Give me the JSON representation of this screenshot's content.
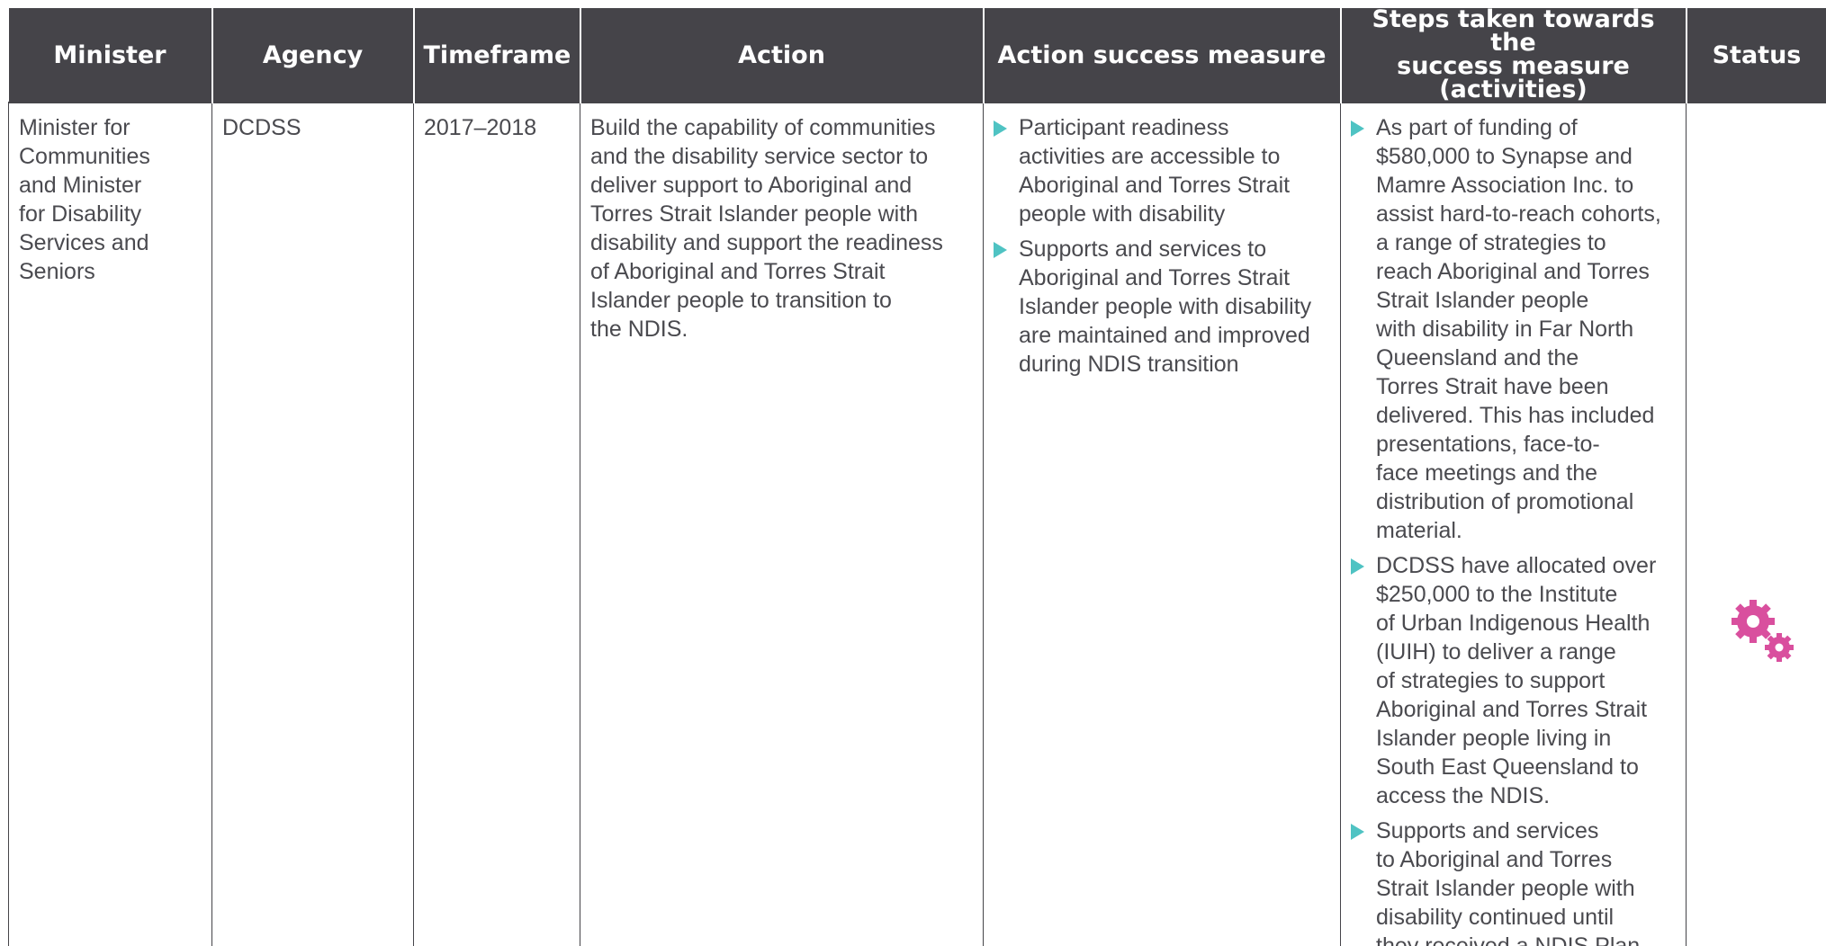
{
  "headers": {
    "minister": "Minister",
    "agency": "Agency",
    "timeframe": "Timeframe",
    "action": "Action",
    "success_measure": "Action success measure",
    "steps_line1": "Steps taken towards the",
    "steps_line2": "success measure (activities)",
    "status": "Status"
  },
  "row": {
    "minister_lines": [
      "Minister for",
      "Communities",
      "and Minister",
      "for Disability",
      "Services and",
      "Seniors"
    ],
    "agency": "DCDSS",
    "timeframe": "2017–2018",
    "action_lines": [
      "Build the capability of communities",
      "and the disability service sector to",
      "deliver support to Aboriginal and",
      "Torres Strait Islander people with",
      "disability and support the readiness",
      "of Aboriginal and Torres Strait",
      "Islander people to transition to",
      "the NDIS."
    ],
    "success_measures": [
      {
        "lines": [
          "Participant readiness",
          "activities are accessible to",
          "Aboriginal and Torres Strait",
          "people with disability"
        ]
      },
      {
        "lines": [
          "Supports and services to",
          "Aboriginal and Torres Strait",
          "Islander people with disability",
          "are maintained and improved",
          "during NDIS transition"
        ]
      }
    ],
    "activities": [
      {
        "lines": [
          "As part of funding of",
          "$580,000 to Synapse and",
          "Mamre Association Inc. to",
          "assist hard-to-reach cohorts,",
          "a range of strategies to",
          "reach Aboriginal and Torres",
          "Strait Islander people",
          "with disability in Far North",
          "Queensland and the",
          "Torres Strait  have been",
          "delivered. This has included",
          "presentations, face-to-",
          "face meetings and the",
          "distribution of promotional",
          "material."
        ]
      },
      {
        "lines": [
          "DCDSS have allocated over",
          "$250,000 to the Institute",
          "of Urban Indigenous Health",
          "(IUIH) to deliver a range",
          "of strategies to support",
          "Aboriginal and Torres Strait",
          "Islander people living in",
          "South East Queensland to",
          "access the NDIS."
        ]
      },
      {
        "lines": [
          "Supports and services",
          "to Aboriginal and Torres",
          "Strait Islander people with",
          "disability continued until",
          "they received a NDIS Plan."
        ]
      }
    ],
    "status_icon": "gears-icon"
  },
  "colors": {
    "header_bg": "#454449",
    "header_text": "#ffffff",
    "body_text": "#4a4a4f",
    "bullet": "#4fc3c3",
    "status_icon": "#d94f9e"
  }
}
